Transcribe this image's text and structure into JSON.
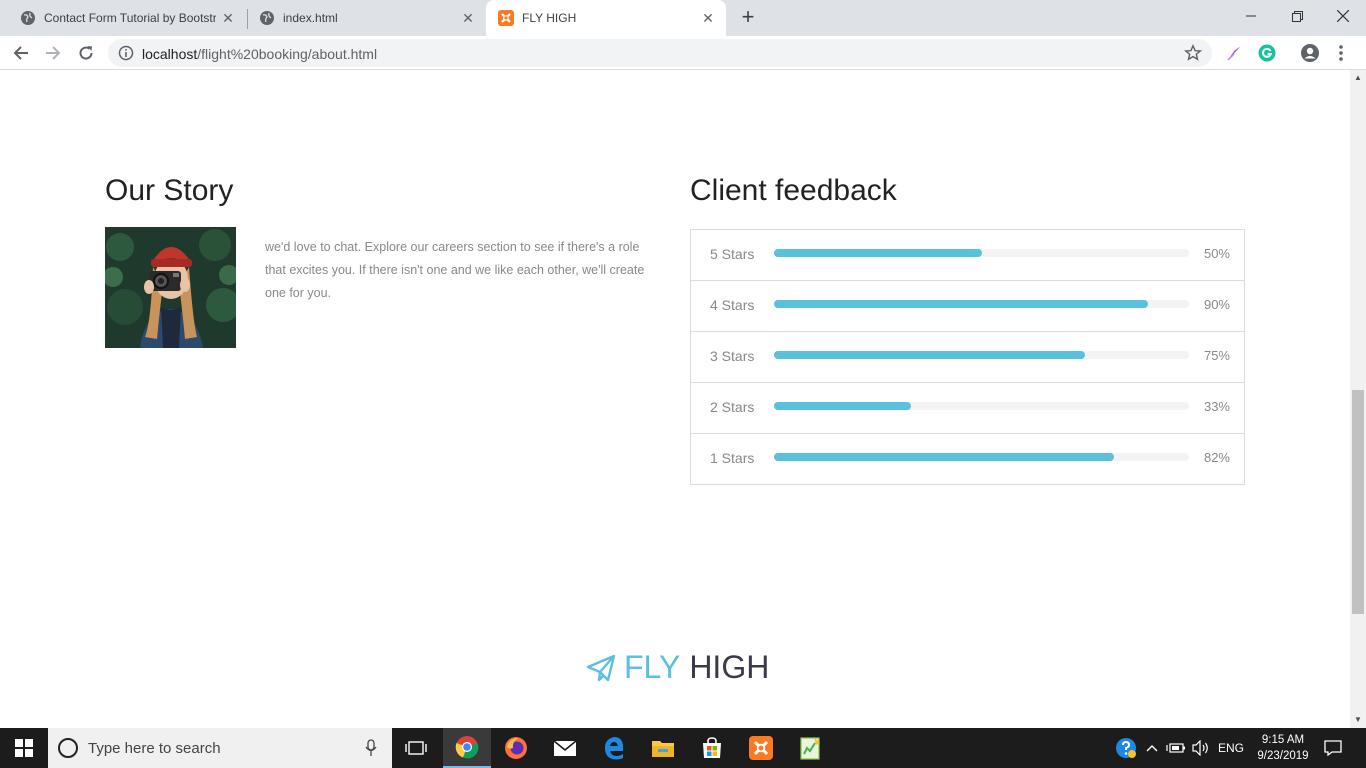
{
  "browser": {
    "tabs": [
      {
        "title": "Contact Form Tutorial by Bootstr",
        "icon": "globe-icon",
        "close": "✕"
      },
      {
        "title": "index.html",
        "icon": "globe-icon",
        "close": "✕"
      },
      {
        "title": "FLY HIGH",
        "icon": "xampp-icon",
        "close": "✕"
      }
    ],
    "new_tab": "+",
    "url_host": "localhost",
    "url_path": "/flight%20booking/about.html"
  },
  "story": {
    "title": "Our Story",
    "text": "we'd love to chat. Explore our careers section to see if there's a role that excites you. If there isn't one and we like each other, we'll create one for you."
  },
  "feedback": {
    "title": "Client feedback",
    "rows": [
      {
        "label": "5 Stars",
        "percent": 50,
        "percent_text": "50%"
      },
      {
        "label": "4 Stars",
        "percent": 90,
        "percent_text": "90%"
      },
      {
        "label": "3 Stars",
        "percent": 75,
        "percent_text": "75%"
      },
      {
        "label": "2 Stars",
        "percent": 33,
        "percent_text": "33%"
      },
      {
        "label": "1 Stars",
        "percent": 82,
        "percent_text": "82%"
      }
    ],
    "bar_color": "#5bc0de"
  },
  "brand": {
    "fly": "FLY",
    "high": "HIGH",
    "icon": "paper-plane-icon"
  },
  "taskbar": {
    "search_placeholder": "Type here to search",
    "language": "ENG",
    "time": "9:15 AM",
    "date": "9/23/2019"
  }
}
